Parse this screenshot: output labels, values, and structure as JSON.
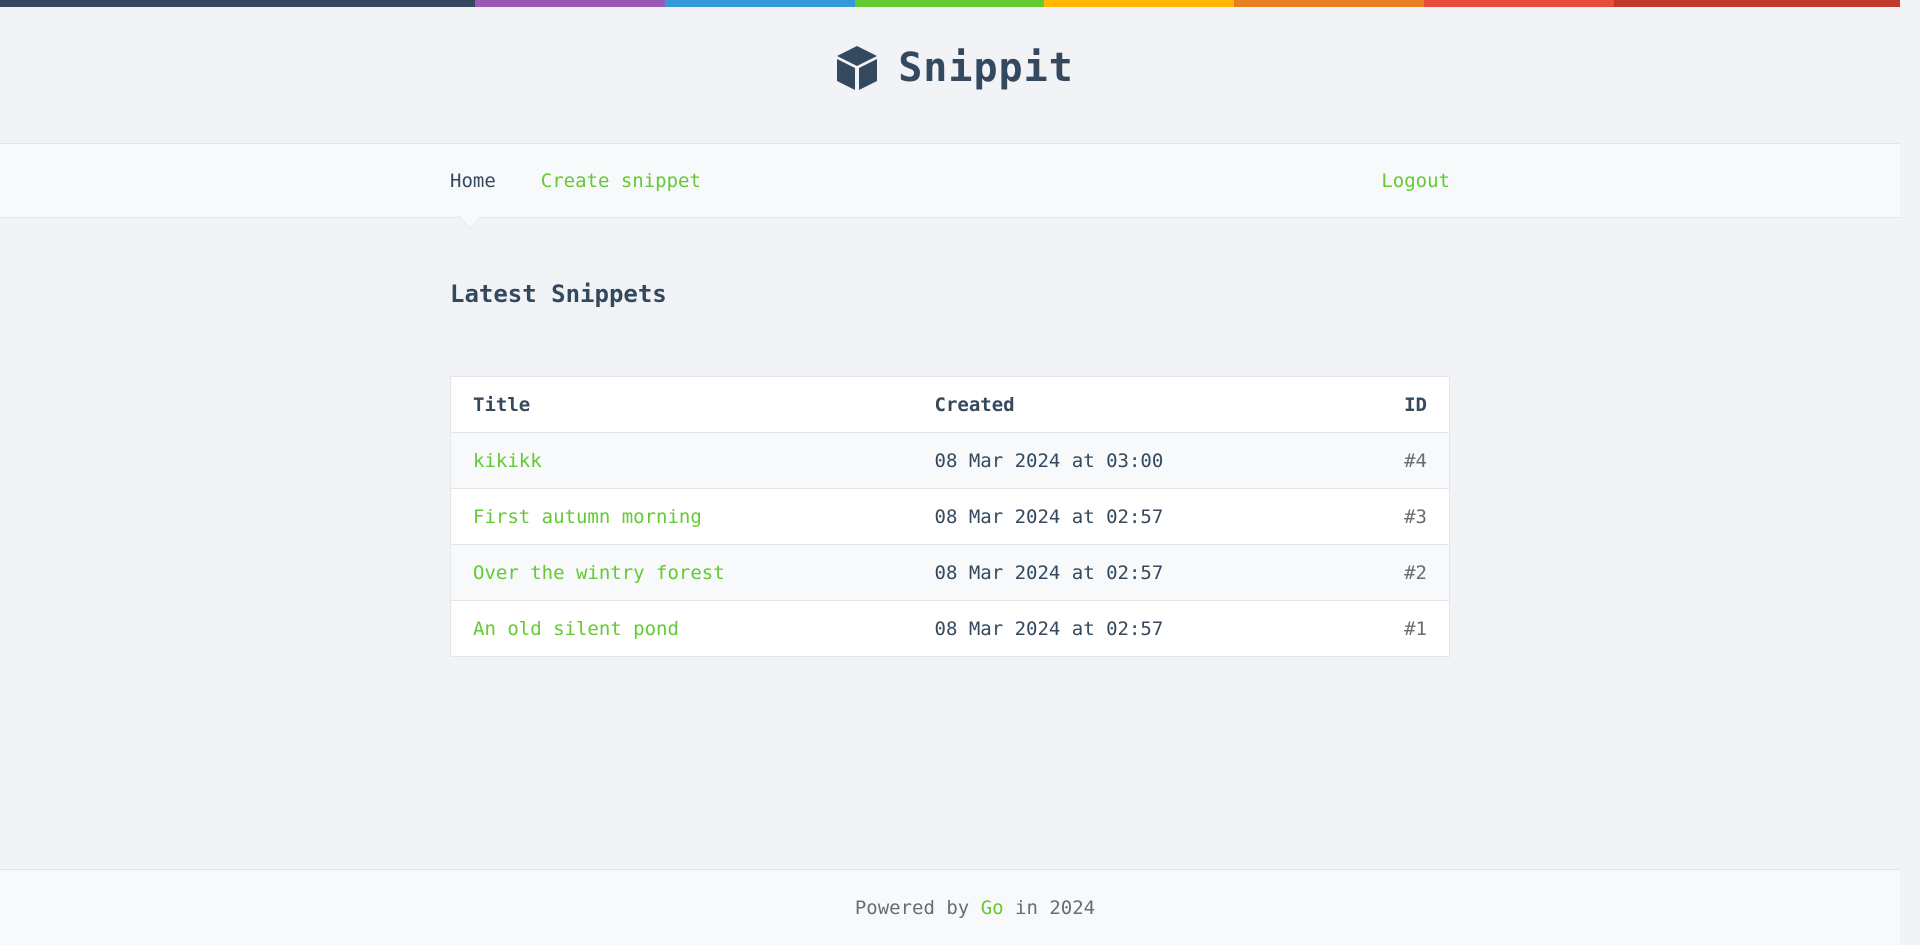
{
  "color_bar": [
    "#34495e",
    "#9b59b6",
    "#3498db",
    "#62cb31",
    "#ffb606",
    "#e67e22",
    "#e74c3c",
    "#c0392b"
  ],
  "brand": {
    "name": "Snippit",
    "icon": "cube-icon",
    "color": "#34495e"
  },
  "nav": {
    "home": "Home",
    "create": "Create snippet",
    "logout": "Logout"
  },
  "main": {
    "title": "Latest Snippets"
  },
  "table": {
    "headers": {
      "title": "Title",
      "created": "Created",
      "id": "ID"
    },
    "rows": [
      {
        "title": "kikikk",
        "created": "08 Mar 2024 at 03:00",
        "id": "#4"
      },
      {
        "title": "First autumn morning",
        "created": "08 Mar 2024 at 02:57",
        "id": "#3"
      },
      {
        "title": "Over the wintry forest",
        "created": "08 Mar 2024 at 02:57",
        "id": "#2"
      },
      {
        "title": "An old silent pond",
        "created": "08 Mar 2024 at 02:57",
        "id": "#1"
      }
    ]
  },
  "footer": {
    "prefix": "Powered by",
    "link": "Go",
    "suffix": "in 2024"
  },
  "colors": {
    "accent": "#62cb31",
    "text": "#34495e",
    "background": "#f1f3f6",
    "panel": "#f7f9fa",
    "border": "#e4e5e7"
  }
}
